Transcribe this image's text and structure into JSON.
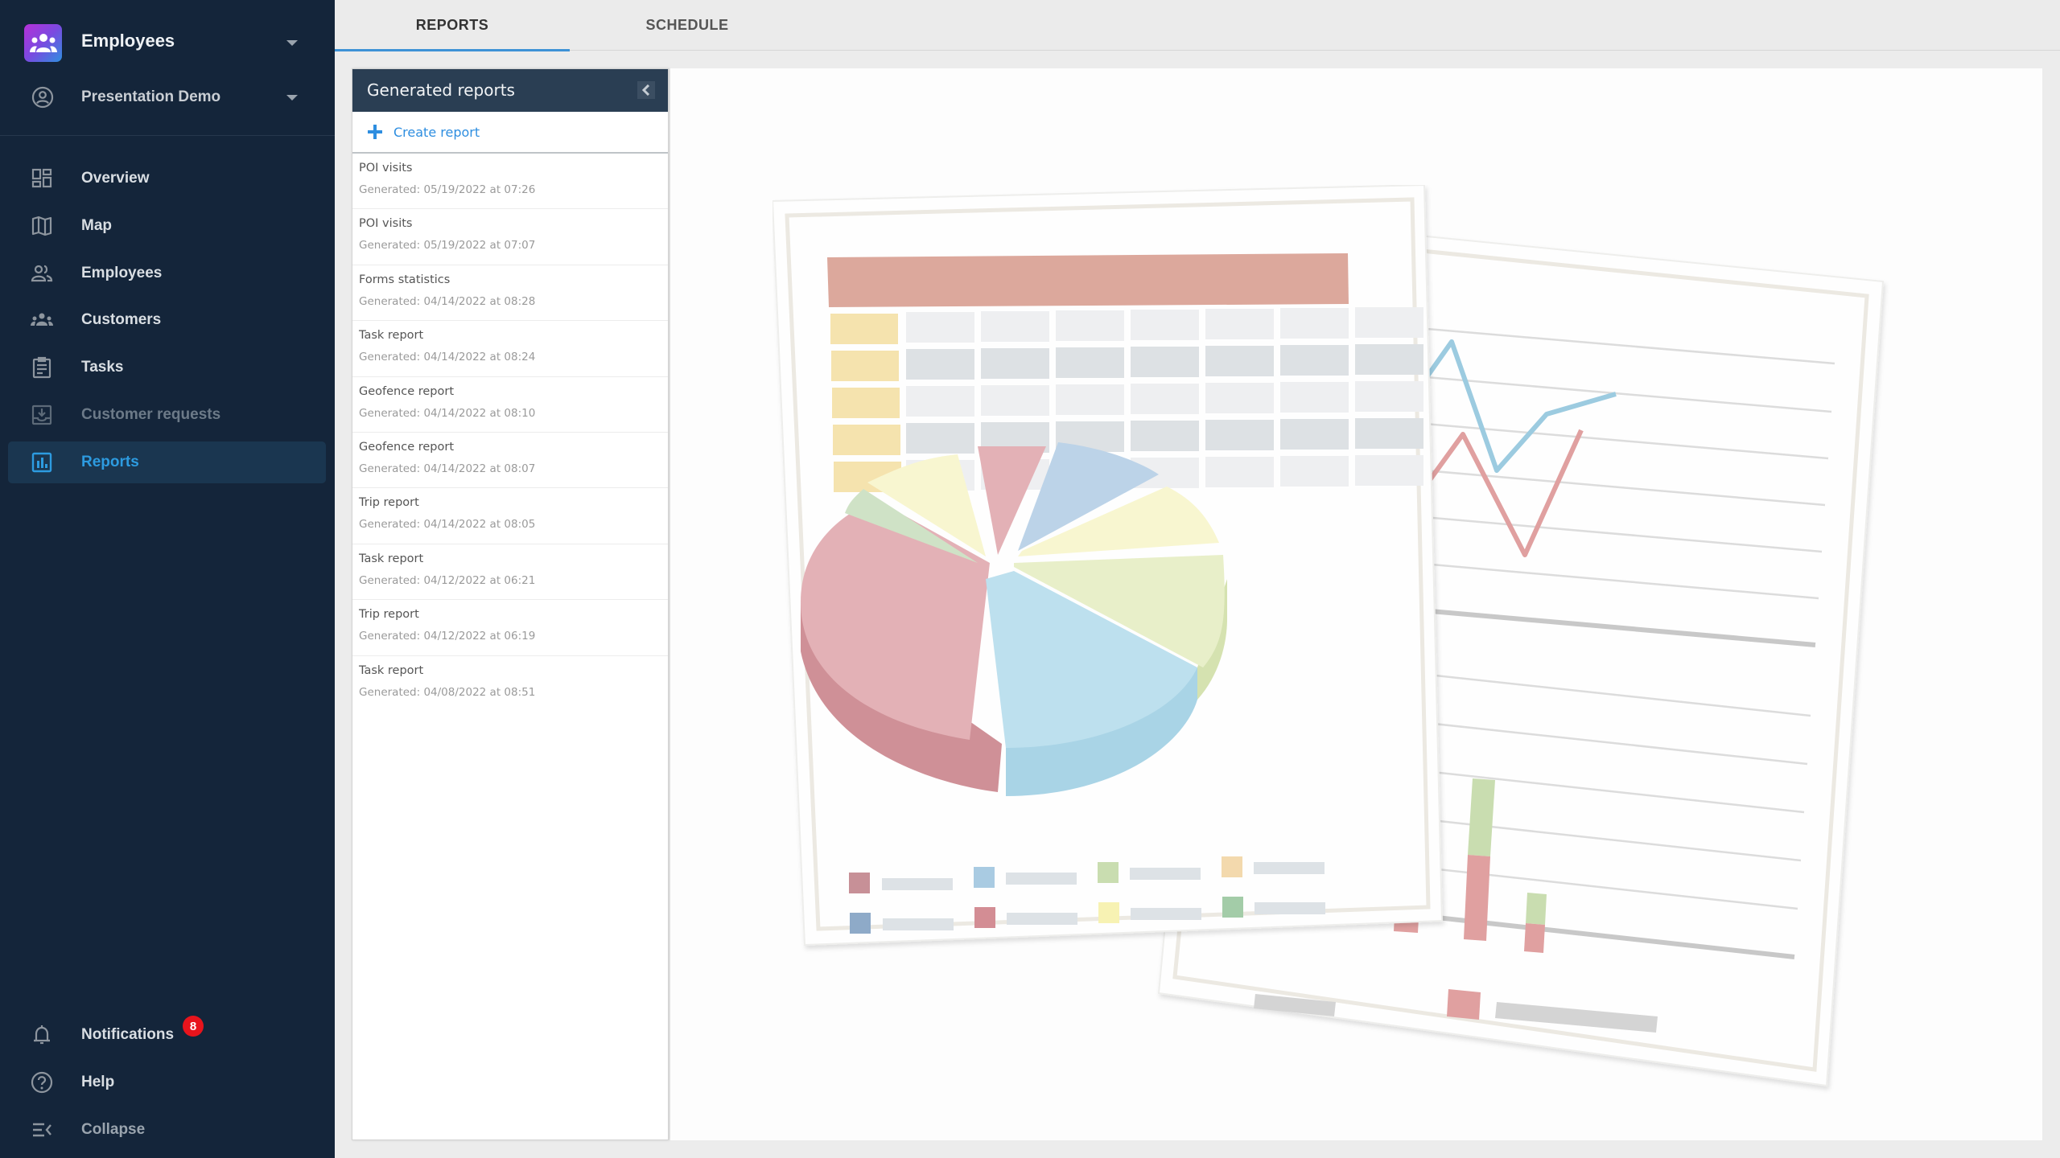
{
  "sidebar": {
    "org": {
      "title": "Employees",
      "icon": "team-icon"
    },
    "account": {
      "name": "Presentation Demo",
      "icon": "account-circle-icon"
    },
    "nav": [
      {
        "label": "Overview",
        "icon": "dashboard-icon"
      },
      {
        "label": "Map",
        "icon": "map-icon"
      },
      {
        "label": "Employees",
        "icon": "people-icon"
      },
      {
        "label": "Customers",
        "icon": "groups-icon"
      },
      {
        "label": "Tasks",
        "icon": "clipboard-icon"
      },
      {
        "label": "Customer requests",
        "icon": "inbox-download-icon"
      },
      {
        "label": "Reports",
        "icon": "bar-chart-icon",
        "active": true
      }
    ],
    "bottom": [
      {
        "label": "Notifications",
        "icon": "bell-icon",
        "badge": "8"
      },
      {
        "label": "Help",
        "icon": "help-circle-icon"
      },
      {
        "label": "Collapse",
        "icon": "collapse-menu-icon"
      }
    ],
    "active_color": "#2d9be0"
  },
  "tabs": [
    {
      "label": "REPORTS",
      "active": true
    },
    {
      "label": "SCHEDULE",
      "active": false
    }
  ],
  "reports_panel": {
    "title": "Generated reports",
    "create_label": "Create report",
    "items": [
      {
        "name": "POI visits",
        "date": "Generated: 05/19/2022 at 07:26"
      },
      {
        "name": "POI visits",
        "date": "Generated: 05/19/2022 at 07:07"
      },
      {
        "name": "Forms statistics",
        "date": "Generated: 04/14/2022 at 08:28"
      },
      {
        "name": "Task report",
        "date": "Generated: 04/14/2022 at 08:24"
      },
      {
        "name": "Geofence report",
        "date": "Generated: 04/14/2022 at 08:10"
      },
      {
        "name": "Geofence report",
        "date": "Generated: 04/14/2022 at 08:07"
      },
      {
        "name": "Trip report",
        "date": "Generated: 04/14/2022 at 08:05"
      },
      {
        "name": "Task report",
        "date": "Generated: 04/12/2022 at 06:21"
      },
      {
        "name": "Trip report",
        "date": "Generated: 04/12/2022 at 06:19"
      },
      {
        "name": "Task report",
        "date": "Generated: 04/08/2022 at 08:51"
      }
    ]
  },
  "main": {
    "illustration": "reports-placeholder-illustration"
  }
}
